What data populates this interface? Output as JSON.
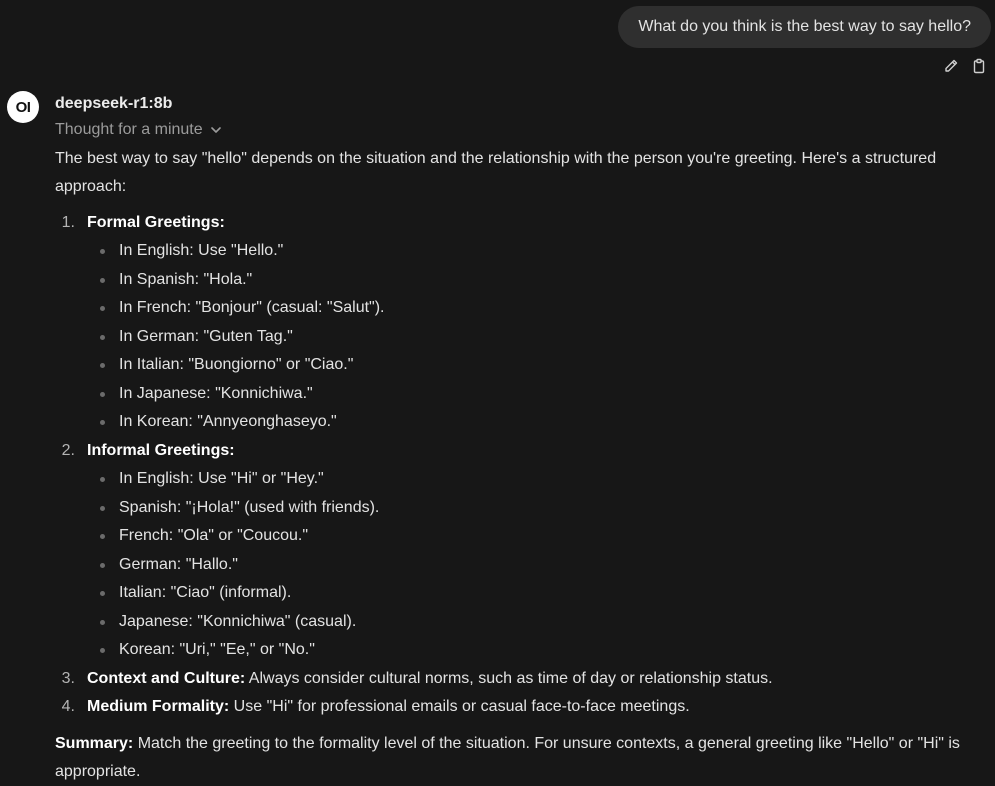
{
  "user_message": "What do you think is the best way to say hello?",
  "user_actions": [
    {
      "icon": "pencil-icon",
      "label": "Edit"
    },
    {
      "icon": "clipboard-icon",
      "label": "Copy"
    }
  ],
  "assistant": {
    "avatar_text": "OI",
    "model_name": "deepseek-r1:8b",
    "thought_label": "Thought for a minute",
    "intro": "The best way to say \"hello\" depends on the situation and the relationship with the person you're greeting. Here's a structured approach:",
    "sections": [
      {
        "number": "1.",
        "title": "Formal Greetings:",
        "text": "",
        "items": [
          "In English: Use \"Hello.\"",
          "In Spanish: \"Hola.\"",
          "In French: \"Bonjour\" (casual: \"Salut\").",
          "In German: \"Guten Tag.\"",
          "In Italian: \"Buongiorno\" or \"Ciao.\"",
          "In Japanese: \"Konnichiwa.\"",
          "In Korean: \"Annyeonghaseyo.\""
        ]
      },
      {
        "number": "2.",
        "title": "Informal Greetings:",
        "text": "",
        "items": [
          "In English: Use \"Hi\" or \"Hey.\"",
          "Spanish: \"¡Hola!\" (used with friends).",
          "French: \"Ola\" or \"Coucou.\"",
          "German: \"Hallo.\"",
          "Italian: \"Ciao\" (informal).",
          "Japanese: \"Konnichiwa\" (casual).",
          "Korean: \"Uri,\" \"Ee,\" or \"No.\""
        ]
      },
      {
        "number": "3.",
        "title": "Context and Culture:",
        "text": " Always consider cultural norms, such as time of day or relationship status.",
        "items": []
      },
      {
        "number": "4.",
        "title": "Medium Formality:",
        "text": " Use \"Hi\" for professional emails or casual face-to-face meetings.",
        "items": []
      }
    ],
    "summary_label": "Summary:",
    "summary_text": " Match the greeting to the formality level of the situation. For unsure contexts, a general greeting like \"Hello\" or \"Hi\" is appropriate."
  }
}
